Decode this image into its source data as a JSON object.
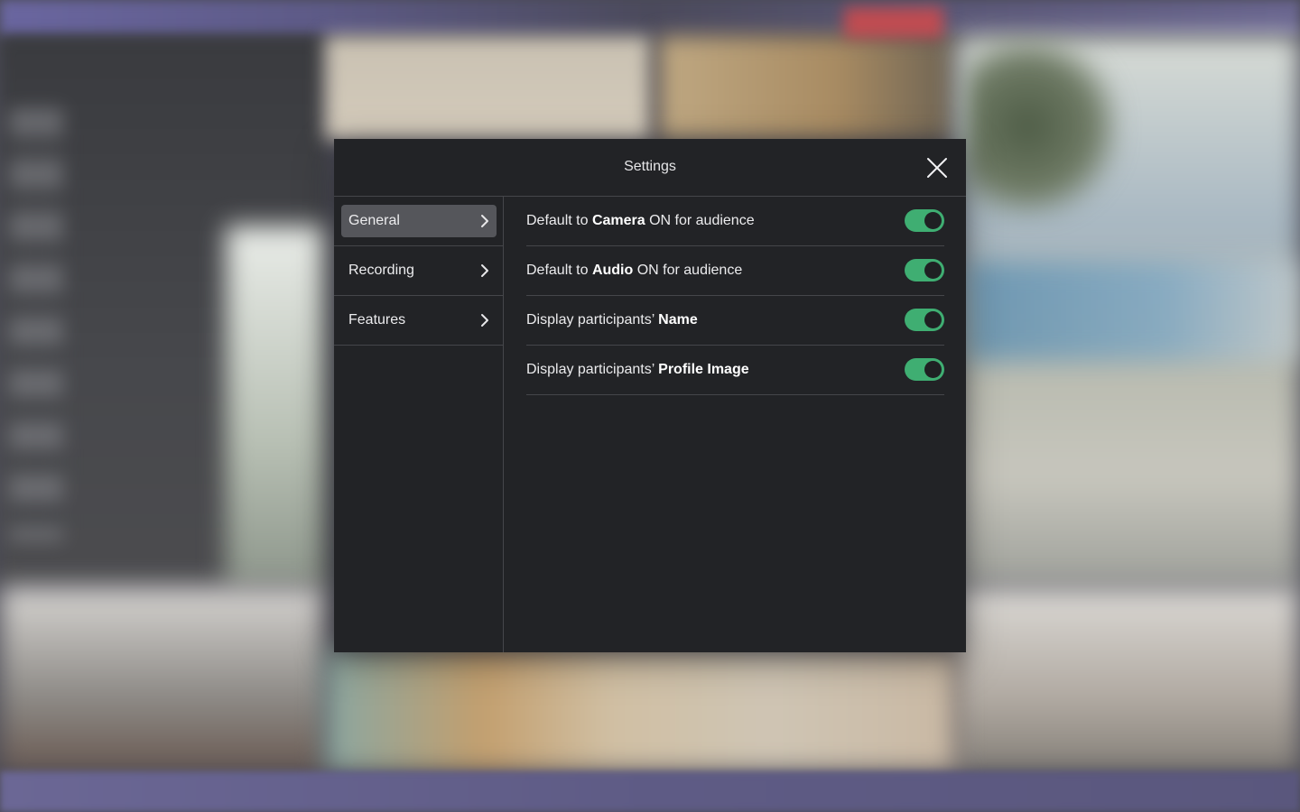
{
  "modal": {
    "title": "Settings",
    "close_icon": "close-icon"
  },
  "sidebar": {
    "items": [
      {
        "label": "General",
        "active": true,
        "icon": "chevron-right-icon"
      },
      {
        "label": "Recording",
        "active": false,
        "icon": "chevron-right-icon"
      },
      {
        "label": "Features",
        "active": false,
        "icon": "chevron-right-icon"
      }
    ]
  },
  "settings": [
    {
      "prefix": "Default to ",
      "bold": "Camera",
      "suffix": " ON for audience",
      "enabled": true
    },
    {
      "prefix": "Default to ",
      "bold": "Audio",
      "suffix": " ON for audience",
      "enabled": true
    },
    {
      "prefix": "Display participants’ ",
      "bold": "Name",
      "suffix": "",
      "enabled": true
    },
    {
      "prefix": "Display participants’ ",
      "bold": "Profile Image",
      "suffix": "",
      "enabled": true
    }
  ],
  "colors": {
    "modal_bg": "#222326",
    "toggle_on": "#3fae72",
    "active_nav": "#55565b",
    "divider": "#45464a"
  }
}
